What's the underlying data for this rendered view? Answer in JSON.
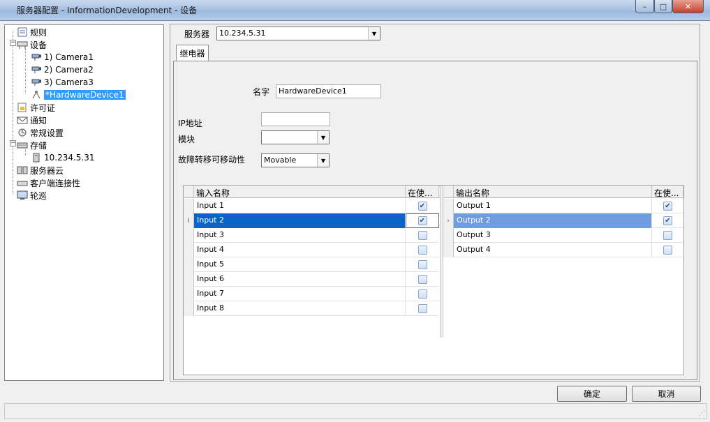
{
  "window": {
    "title": "服务器配置 - InformationDevelopment - 设备",
    "minimize": "–",
    "maximize": "□",
    "close": "✕"
  },
  "tree": {
    "items": [
      {
        "label": "规则",
        "icon": "rules-icon"
      },
      {
        "label": "设备",
        "icon": "devices-icon"
      },
      {
        "label": "1) Camera1",
        "icon": "camera-icon"
      },
      {
        "label": "2) Camera2",
        "icon": "camera-icon"
      },
      {
        "label": "3) Camera3",
        "icon": "camera-icon"
      },
      {
        "label": "*HardwareDevice1",
        "icon": "hardware-device-icon"
      },
      {
        "label": "许可证",
        "icon": "license-icon"
      },
      {
        "label": "通知",
        "icon": "notification-icon"
      },
      {
        "label": "常规设置",
        "icon": "settings-icon"
      },
      {
        "label": "存储",
        "icon": "storage-icon"
      },
      {
        "label": "10.234.5.31",
        "icon": "server-storage-icon"
      },
      {
        "label": "服务器云",
        "icon": "server-cloud-icon"
      },
      {
        "label": "客户端连接性",
        "icon": "client-connectivity-icon"
      },
      {
        "label": "轮巡",
        "icon": "tour-icon"
      }
    ]
  },
  "server": {
    "label": "服务器",
    "value": "10.234.5.31"
  },
  "tab": {
    "label": "继电器"
  },
  "form": {
    "name_label": "名字",
    "name_value": "HardwareDevice1",
    "ip_label": "IP地址",
    "ip_value": "",
    "module_label": "模块",
    "module_value": "",
    "failover_label": "故障转移可移动性",
    "failover_value": "Movable"
  },
  "inputs": {
    "col_name": "输入名称",
    "col_used": "在使...",
    "rows": [
      {
        "name": "Input 1",
        "checked": true
      },
      {
        "name": "Input 2",
        "checked": true
      },
      {
        "name": "Input 3",
        "checked": false
      },
      {
        "name": "Input 4",
        "checked": false
      },
      {
        "name": "Input 5",
        "checked": false
      },
      {
        "name": "Input 6",
        "checked": false
      },
      {
        "name": "Input 7",
        "checked": false
      },
      {
        "name": "Input 8",
        "checked": false
      }
    ]
  },
  "outputs": {
    "col_name": "输出名称",
    "col_used": "在使...",
    "rows": [
      {
        "name": "Output 1",
        "checked": true
      },
      {
        "name": "Output 2",
        "checked": true
      },
      {
        "name": "Output 3",
        "checked": false
      },
      {
        "name": "Output 4",
        "checked": false
      }
    ]
  },
  "buttons": {
    "ok": "确定",
    "cancel": "取消"
  },
  "colors": {
    "selection_dark": "#0a64c8",
    "selection_light": "#6f9de0",
    "tree_selection": "#3399ff"
  }
}
